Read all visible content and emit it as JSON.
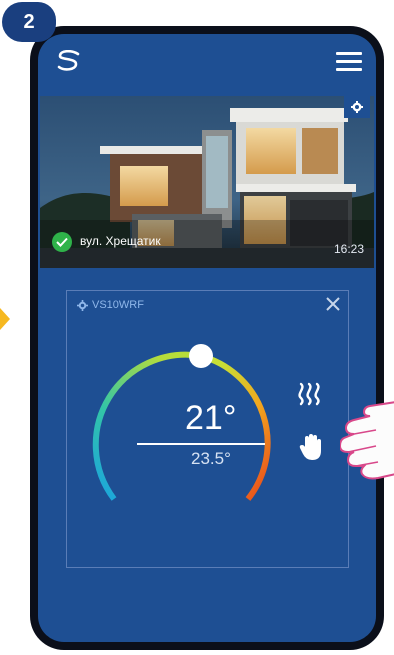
{
  "step": {
    "number": "2"
  },
  "app": {
    "logo": "salus-logo",
    "menu_icon": "hamburger-icon"
  },
  "location": {
    "address": "вул. Хрещатик",
    "time": "16:23",
    "status": "online",
    "status_icon": "check-icon"
  },
  "device": {
    "name": "VS10WRF",
    "current_temp": "21°",
    "set_temp": "23.5°",
    "mode_icons": [
      "heating-icon",
      "manual-mode-icon"
    ]
  },
  "colors": {
    "screen_bg": "#1e4f93",
    "accent": "#8fb7ea",
    "online": "#2fb34a",
    "badge": "#1a3f7f"
  }
}
